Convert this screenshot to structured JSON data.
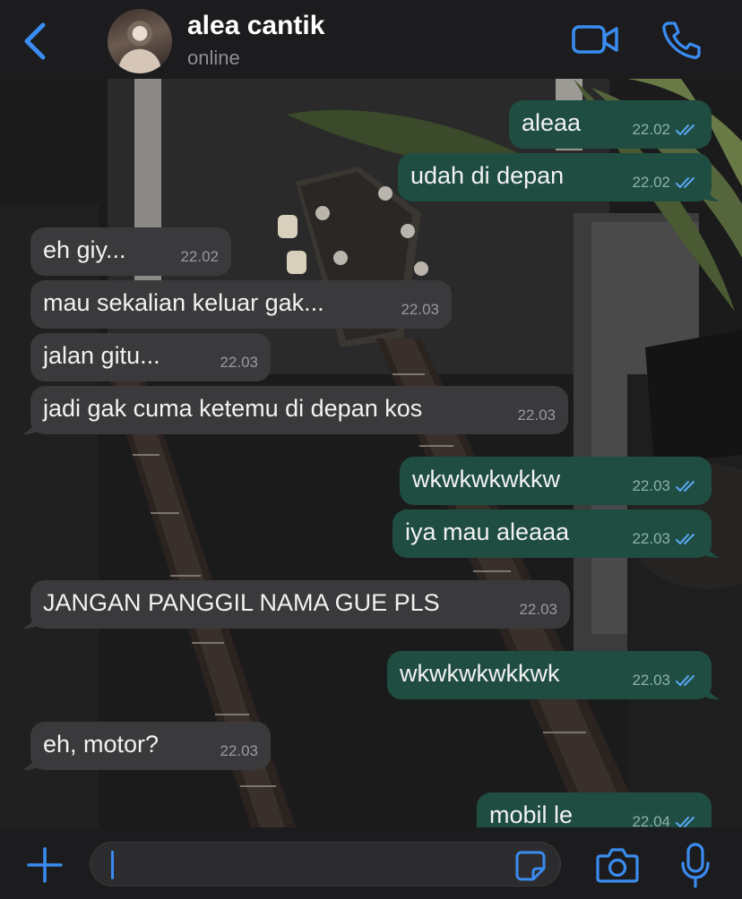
{
  "header": {
    "back_icon": "chevron-left-icon",
    "contact_name": "alea cantik",
    "status": "online",
    "video_icon": "video-camera-icon",
    "call_icon": "phone-icon"
  },
  "messages": [
    {
      "dir": "out",
      "text": "aleaa",
      "time": "22.02",
      "read": true
    },
    {
      "dir": "out",
      "text": "udah di depan",
      "time": "22.02",
      "read": true
    },
    {
      "dir": "in",
      "text": "eh giy...",
      "time": "22.02"
    },
    {
      "dir": "in",
      "text": "mau sekalian keluar gak...",
      "time": "22.03"
    },
    {
      "dir": "in",
      "text": "jalan gitu...",
      "time": "22.03"
    },
    {
      "dir": "in",
      "text": "jadi gak cuma ketemu di depan kos",
      "time": "22.03"
    },
    {
      "dir": "out",
      "text": "wkwkwkwkkw",
      "time": "22.03",
      "read": true
    },
    {
      "dir": "out",
      "text": "iya mau aleaaa",
      "time": "22.03",
      "read": true
    },
    {
      "dir": "in",
      "text": "JANGAN PANGGIL NAMA GUE PLS",
      "time": "22.03"
    },
    {
      "dir": "out",
      "text": "wkwkwkwkkwk",
      "time": "22.03",
      "read": true
    },
    {
      "dir": "in",
      "text": "eh, motor?",
      "time": "22.03"
    },
    {
      "dir": "out",
      "text": "mobil le",
      "time": "22.04",
      "read": true
    }
  ],
  "footer": {
    "plus_icon": "plus-icon",
    "input_value": "",
    "sticker_icon": "sticker-icon",
    "camera_icon": "camera-icon",
    "mic_icon": "microphone-icon"
  },
  "colors": {
    "accent": "#3a8cf0",
    "incoming_bubble": "#3a3a3c",
    "outgoing_bubble": "#1f4d42",
    "read_ticks": "#5aa9f5",
    "header_bg": "#1c1c1e"
  }
}
